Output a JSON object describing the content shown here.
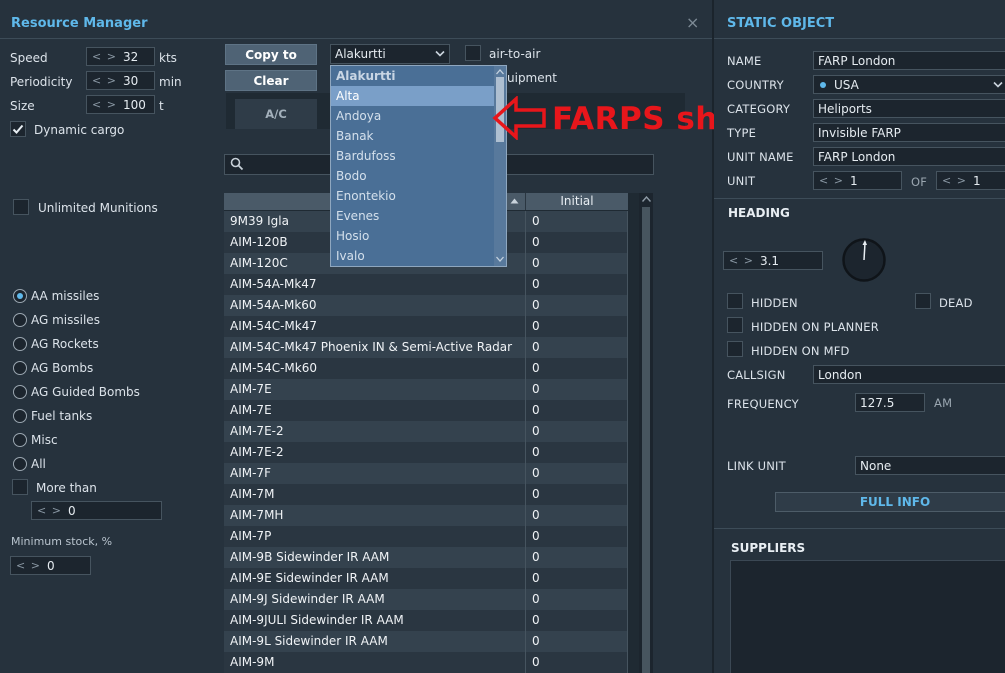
{
  "left_panel": {
    "title": "Resource Manager",
    "close_glyph": "×",
    "speed": {
      "label": "Speed",
      "value": "32",
      "unit": "kts"
    },
    "periodicity": {
      "label": "Periodicity",
      "value": "30",
      "unit": "min"
    },
    "size": {
      "label": "Size",
      "value": "100",
      "unit": "t"
    },
    "dynamic_cargo": {
      "label": "Dynamic cargo",
      "checked": true
    },
    "unlimited_munitions": {
      "label": "Unlimited Munitions",
      "checked": false
    },
    "categories": [
      {
        "label": "AA missiles",
        "selected": true
      },
      {
        "label": "AG missiles",
        "selected": false
      },
      {
        "label": "AG Rockets",
        "selected": false
      },
      {
        "label": "AG Bombs",
        "selected": false
      },
      {
        "label": "AG Guided Bombs",
        "selected": false
      },
      {
        "label": "Fuel tanks",
        "selected": false
      },
      {
        "label": "Misc",
        "selected": false
      },
      {
        "label": "All",
        "selected": false
      }
    ],
    "more_than": {
      "label": "More than",
      "value": "0"
    },
    "minimum_stock": {
      "label": "Minimum stock, %",
      "value": "0"
    },
    "copy_to_label": "Copy to",
    "clear_label": "Clear",
    "airfield_select": "Alakurtti",
    "air_to_air_label": "air-to-air",
    "equipment_label_visible": "uipment",
    "tab_ac": "A/C",
    "table": {
      "header_initial": "Initial",
      "rows": [
        {
          "name": "9M39 Igla",
          "initial": "0"
        },
        {
          "name": "AIM-120B",
          "initial": "0"
        },
        {
          "name": "AIM-120C",
          "initial": "0"
        },
        {
          "name": "AIM-54A-Mk47",
          "initial": "0"
        },
        {
          "name": "AIM-54A-Mk60",
          "initial": "0"
        },
        {
          "name": "AIM-54C-Mk47",
          "initial": "0"
        },
        {
          "name": "AIM-54C-Mk47 Phoenix IN & Semi-Active Radar",
          "initial": "0"
        },
        {
          "name": "AIM-54C-Mk60",
          "initial": "0"
        },
        {
          "name": "AIM-7E",
          "initial": "0"
        },
        {
          "name": "AIM-7E",
          "initial": "0"
        },
        {
          "name": "AIM-7E-2",
          "initial": "0"
        },
        {
          "name": "AIM-7E-2",
          "initial": "0"
        },
        {
          "name": "AIM-7F",
          "initial": "0"
        },
        {
          "name": "AIM-7M",
          "initial": "0"
        },
        {
          "name": "AIM-7MH",
          "initial": "0"
        },
        {
          "name": "AIM-7P",
          "initial": "0"
        },
        {
          "name": "AIM-9B Sidewinder IR AAM",
          "initial": "0"
        },
        {
          "name": "AIM-9E Sidewinder IR AAM",
          "initial": "0"
        },
        {
          "name": "AIM-9J Sidewinder IR AAM",
          "initial": "0"
        },
        {
          "name": "AIM-9JULI Sidewinder IR AAM",
          "initial": "0"
        },
        {
          "name": "AIM-9L Sidewinder IR AAM",
          "initial": "0"
        },
        {
          "name": "AIM-9M",
          "initial": "0"
        }
      ]
    },
    "dropdown_items": [
      "Alakurtti",
      "Alta",
      "Andoya",
      "Banak",
      "Bardufoss",
      "Bodo",
      "Enontekio",
      "Evenes",
      "Hosio",
      "Ivalo"
    ],
    "dropdown_selected_index": 1
  },
  "annotation": {
    "text": "FARPS show up in list",
    "color": "#e8161b"
  },
  "right_panel": {
    "title": "STATIC OBJECT",
    "name": {
      "label": "NAME",
      "value": "FARP London"
    },
    "country": {
      "label": "COUNTRY",
      "value": "USA"
    },
    "category": {
      "label": "CATEGORY",
      "value": "Heliports"
    },
    "type": {
      "label": "TYPE",
      "value": "Invisible FARP"
    },
    "unit_name": {
      "label": "UNIT NAME",
      "value": "FARP London"
    },
    "unit": {
      "label": "UNIT",
      "value": "1",
      "of_label": "OF",
      "of_value": "1"
    },
    "heading": {
      "label": "HEADING",
      "value": "3.1"
    },
    "hidden": {
      "label": "HIDDEN"
    },
    "dead": {
      "label": "DEAD"
    },
    "hidden_planner": {
      "label": "HIDDEN ON PLANNER"
    },
    "hidden_mfd": {
      "label": "HIDDEN ON MFD"
    },
    "callsign": {
      "label": "CALLSIGN",
      "value": "London"
    },
    "frequency": {
      "label": "FREQUENCY",
      "value": "127.5",
      "unit": "AM"
    },
    "link_unit": {
      "label": "LINK UNIT",
      "value": "None"
    },
    "full_info_label": "FULL INFO",
    "suppliers_label": "SUPPLIERS"
  },
  "colors": {
    "accent": "#5fb8ea",
    "background": "#26323d",
    "annotation_red": "#e8161b"
  }
}
